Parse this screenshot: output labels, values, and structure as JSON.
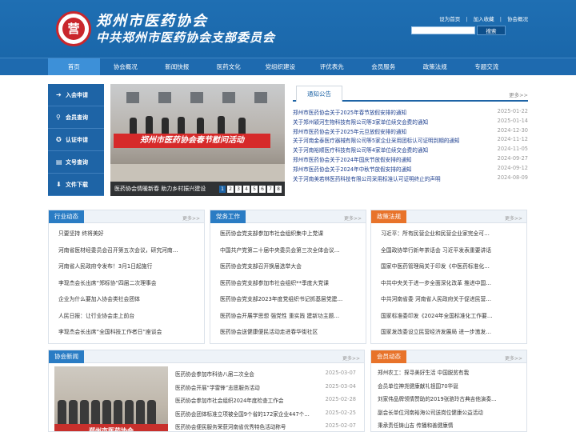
{
  "header": {
    "logo_char": "营",
    "title_line1": "郑州市医药协会",
    "title_line2": "中共郑州市医药协会支部委员会",
    "links": [
      "设为首页",
      "加入收藏",
      "协会概况"
    ],
    "search_button": "搜索",
    "colors": {
      "bg": "#1f6fb3",
      "nav_active": "#3d90d8"
    }
  },
  "nav": [
    "首页",
    "协会概况",
    "新闻快报",
    "医药文化",
    "党组织建设",
    "评优表先",
    "会员服务",
    "政策法规",
    "专题交流"
  ],
  "quick_menu": [
    {
      "icon": "login-icon",
      "label": "入会申请"
    },
    {
      "icon": "search-icon",
      "label": "会员查询"
    },
    {
      "icon": "badge-icon",
      "label": "认证申请"
    },
    {
      "icon": "document-icon",
      "label": "文号查询"
    },
    {
      "icon": "download-icon",
      "label": "文件下载"
    }
  ],
  "slider": {
    "banner": "郑州市医药协会春节慰问活动",
    "caption": "医药协会情暖新春 助力乡村振兴建设",
    "pages": [
      "1",
      "2",
      "3",
      "4",
      "5",
      "6",
      "7",
      "8"
    ],
    "active_page": "1"
  },
  "notice": {
    "tab": "通知公告",
    "more": "更多>>",
    "items": [
      {
        "title": "郑州市医药协会关于2025年春节放假安排的通知",
        "date": "2025-01-22"
      },
      {
        "title": "关于郑州颖河生物科技有限公司等3家单位续交会费的通知",
        "date": "2025-01-14"
      },
      {
        "title": "郑州市医药协会关于2025年元旦放假安排的通知",
        "date": "2024-12-30"
      },
      {
        "title": "关于河南金泰医疗器械有限公司等5家企业采用团标认可证明到期的通知",
        "date": "2024-11-12"
      },
      {
        "title": "关于河南裕顺医疗科技有限公司等4家单位续交会费的通知",
        "date": "2024-11-05"
      },
      {
        "title": "郑州市医药协会关于2024年国庆节放假安排的通知",
        "date": "2024-09-27"
      },
      {
        "title": "郑州市医药协会关于2024年中秋节放假安排的通知",
        "date": "2024-09-12"
      },
      {
        "title": "关于河南美若林医药科技有限公司采用标准认可证明终止的声明",
        "date": "2024-08-09"
      }
    ]
  },
  "panels": [
    {
      "title": "行业动态",
      "color": "#2a7cc4",
      "more": "更多>>",
      "items": [
        "只要坚持 终将美好",
        "河南省医材经委员会召开第五次会议，研究河南…",
        "河南省人民政府令发布！3月1日起施行",
        "李现杰会长出席“郑标协”四届二次理事会",
        "企业为什么要加入协会类社会团体",
        "人民日报：让行业协会走上前台",
        "李现杰会长出席“全国科技工作者日”座谈会"
      ]
    },
    {
      "title": "党务工作",
      "color": "#2a7cc4",
      "more": "更多>>",
      "items": [
        "医药协会党支部参加市社会组织集中上党课",
        "中国共产党第二十届中央委员会第三次全体会议…",
        "医药协会党支部召开换届选举大会",
        "医药协会党支部参加市社会组织**季度大党课",
        "医药协会党支部2023年度党组织书记抓基层党建…",
        "医药协会开展学思想 强党性 重实践 建新功主题…",
        "医药协会送健康便民活动走进春华街社区"
      ]
    },
    {
      "title": "政策法规",
      "color": "#e8732a",
      "more": "更多>>",
      "items": [
        "习近平：所有民营企业和民营企业家完全可…",
        "全国政协举行新年茶话会 习近平发表重要讲话",
        "国家中医药管理局关于印发《中医药标准化…",
        "中共中央关于进一步全面深化改革 推进中国…",
        "中共河南省委 河南省人民政府关于促进民营…",
        "国家标准委印发《2024年全国标准化工作要…",
        "国家发改委设立民营经济发展局 进一步激发…"
      ]
    }
  ],
  "bottom": {
    "news": {
      "title": "协会新闻",
      "color": "#2a7cc4",
      "more": "更多>>",
      "photo_banner": "郑州市医药协会",
      "items": [
        {
          "title": "医药协会参加市科协八届二次全会",
          "date": "2025-03-07"
        },
        {
          "title": "医药协会开展“学雷锋”志愿服务活动",
          "date": "2025-03-04"
        },
        {
          "title": "医药协会参加市社会组织2024年度检查工作会",
          "date": "2025-02-28"
        },
        {
          "title": "医药协会团体标准立项被全国9个省的172家企业447个…",
          "date": "2025-02-25"
        },
        {
          "title": "医药协会便民服务荣获河南省优秀特色活动称号",
          "date": "2025-02-07"
        }
      ]
    },
    "members": {
      "title": "会员动态",
      "color": "#e8732a",
      "more": "更多>>",
      "items": [
        "郑州农工：探寻美好生活 中国脱贫有我",
        "会员单位神尧健康献礼祖国70华诞",
        "刘家伟品牌领情赞助的2019张骆玲古典吉他演奏…",
        "副会长单位河南裕海公司送岗位健康公益活动",
        "秉承责任铸山吉 传播和善健康情"
      ]
    }
  }
}
